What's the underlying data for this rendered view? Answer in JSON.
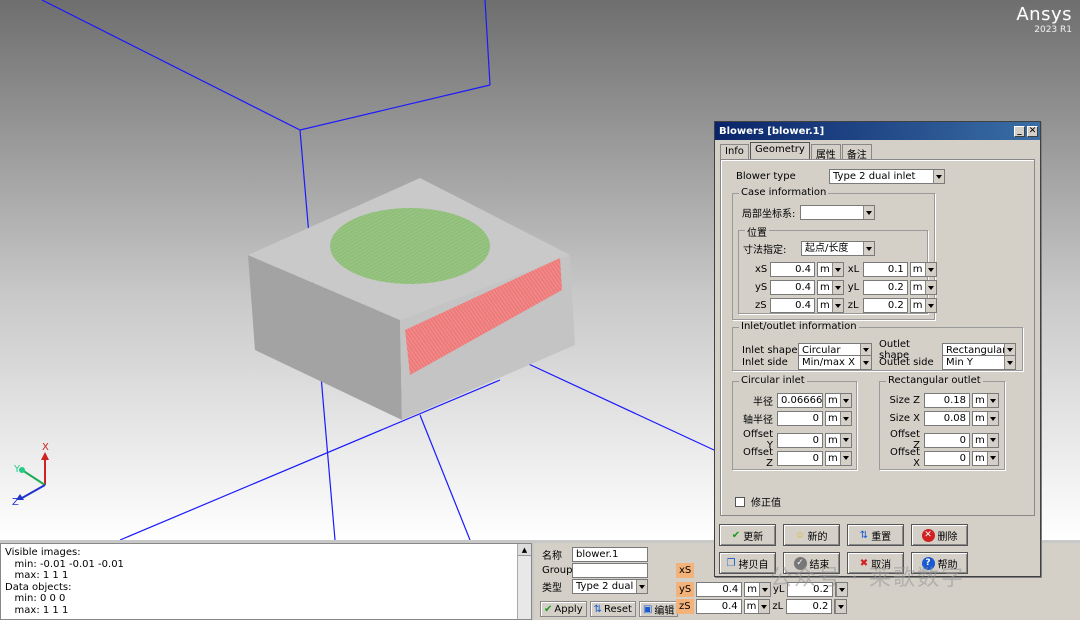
{
  "brand": {
    "name": "Ansys",
    "version": "2023 R1"
  },
  "colors": {
    "viewport_bg_top": "#707070",
    "box_side": "#a6a6a6",
    "box_top": "#c4c4c4",
    "inlet": "#8dbb78",
    "outlet": "#e86a6a",
    "wire": "#1a1aff",
    "dialog_title": "#0a246a"
  },
  "axes": {
    "x": "X",
    "y": "Y",
    "z": "Z"
  },
  "messages": [
    "Visible images:",
    "   min: -0.01 -0.01 -0.01",
    "   max: 1 1 1",
    "Data objects:",
    "   min: 0 0 0",
    "   max: 1 1 1"
  ],
  "edit": {
    "name_label": "名称",
    "name_value": "blower.1",
    "group_label": "Group",
    "group_value": "",
    "type_label": "类型",
    "type_value": "Type 2 dual inl",
    "apply": "Apply",
    "reset": "Reset",
    "edit_btn": "编辑",
    "xS": "xS",
    "yS": "yS",
    "zS": "zS",
    "yL": "yL",
    "zL": "zL",
    "yS_value": "0.4",
    "zS_value": "0.4",
    "yL_value": "0.2",
    "zL_value": "0.2",
    "unit": "m"
  },
  "dialog": {
    "title": "Blowers [blower.1]",
    "tabs": [
      "Info",
      "Geometry",
      "属性",
      "备注"
    ],
    "blower_type_label": "Blower type",
    "blower_type_value": "Type 2 dual inlet",
    "case_info": "Case information",
    "local_coord_label": "局部坐标系:",
    "local_coord_value": "",
    "position": "位置",
    "size_spec_label": "寸法指定:",
    "size_spec_value": "起点/长度",
    "xS": "xS",
    "yS": "yS",
    "zS": "zS",
    "xL": "xL",
    "yL": "yL",
    "zL": "zL",
    "xS_value": "0.4",
    "yS_value": "0.4",
    "zS_value": "0.4",
    "xL_value": "0.1",
    "yL_value": "0.2",
    "zL_value": "0.2",
    "unit": "m",
    "io_info": "Inlet/outlet information",
    "inlet_shape_label": "Inlet shape",
    "inlet_shape_value": "Circular",
    "outlet_shape_label": "Outlet shape",
    "outlet_shape_value": "Rectangular",
    "inlet_side_label": "Inlet side",
    "inlet_side_value": "Min/max X",
    "outlet_side_label": "Outlet side",
    "outlet_side_value": "Min Y",
    "circular_inlet": "Circular inlet",
    "radius_label": "半径",
    "radius_value": "0.066666€",
    "axis_radius_label": "轴半径",
    "axis_radius_value": "0",
    "offset_y_label": "Offset Y",
    "offset_y_value": "0",
    "offset_z_label": "Offset Z",
    "offset_z_value": "0",
    "rect_outlet": "Rectangular outlet",
    "size_z_label": "Size Z",
    "size_z_value": "0.18",
    "size_x_label": "Size X",
    "size_x_value": "0.08",
    "roffset_z_label": "Offset Z",
    "roffset_z_value": "0",
    "roffset_x_label": "Offset X",
    "roffset_x_value": "0",
    "modify_label": "修正值",
    "buttons": {
      "update": "更新",
      "new": "新的",
      "reset": "重置",
      "delete": "删除",
      "copy": "拷贝自",
      "done": "结束",
      "cancel": "取消",
      "help": "帮助"
    }
  },
  "watermark": "公众号 · 莱歌数字"
}
